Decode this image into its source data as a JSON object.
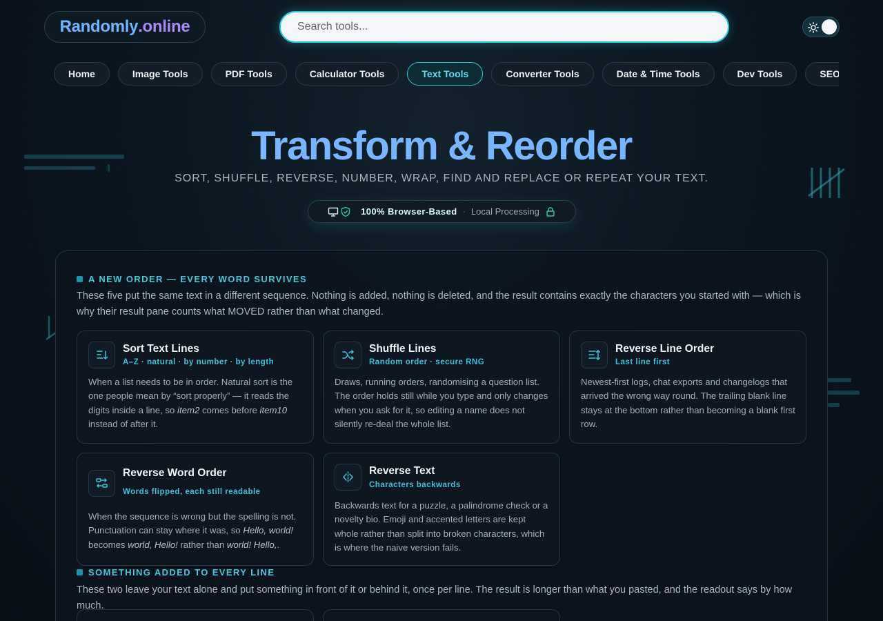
{
  "header": {
    "logo_part1": "Randomly",
    "logo_part2": ".online",
    "search_placeholder": "Search tools..."
  },
  "nav": {
    "items": [
      "Home",
      "Image Tools",
      "PDF Tools",
      "Calculator Tools",
      "Text Tools",
      "Converter Tools",
      "Date & Time Tools",
      "Dev Tools",
      "SEO"
    ],
    "active": "Text Tools"
  },
  "hero": {
    "title": "Transform & Reorder",
    "subtitle": "SORT, SHUFFLE, REVERSE, NUMBER, WRAP, FIND AND REPLACE OR REPEAT YOUR TEXT.",
    "badge_strong": "100% Browser-Based",
    "badge_sep": "·",
    "badge_weak": "Local Processing"
  },
  "sections": [
    {
      "heading": "A NEW ORDER — EVERY WORD SURVIVES",
      "description": "These five put the same text in a different sequence. Nothing is added, nothing is deleted, and the result contains exactly the characters you started with — which is why their result pane counts what MOVED rather than what changed."
    },
    {
      "heading": "SOMETHING ADDED TO EVERY LINE",
      "description": "These two leave your text alone and put something in front of it or behind it, once per line. The result is longer than what you pasted, and the readout says by how much."
    }
  ],
  "cards": [
    {
      "title": "Sort Text Lines",
      "tag": "A–Z · natural · by number · by length",
      "icon": "sort-icon",
      "body": [
        {
          "t": "When a list needs to be in order. Natural sort is the one people mean by “sort properly” — it reads the digits inside a line, so "
        },
        {
          "t": "item2",
          "em": true
        },
        {
          "t": " comes before "
        },
        {
          "t": "item10",
          "em": true
        },
        {
          "t": " instead of after it."
        }
      ]
    },
    {
      "title": "Shuffle Lines",
      "tag": "Random order · secure RNG",
      "icon": "shuffle-icon",
      "body": [
        {
          "t": "Draws, running orders, randomising a question list. The order holds still while you type and only changes when you ask for it, so editing a name does not silently re-deal the whole list."
        }
      ]
    },
    {
      "title": "Reverse Line Order",
      "tag": "Last line first",
      "icon": "reverse-lines-icon",
      "body": [
        {
          "t": "Newest-first logs, chat exports and changelogs that arrived the wrong way round. The trailing blank line stays at the bottom rather than becoming a blank first row."
        }
      ]
    },
    {
      "title": "Reverse Word Order",
      "tag": "Words flipped, each still readable",
      "icon": "swap-words-icon",
      "body": [
        {
          "t": "When the sequence is wrong but the spelling is not. Punctuation can stay where it was, so "
        },
        {
          "t": "Hello, world!",
          "em": true
        },
        {
          "t": " becomes "
        },
        {
          "t": "world, Hello!",
          "em": true
        },
        {
          "t": " rather than "
        },
        {
          "t": "world! Hello,",
          "em": true
        },
        {
          "t": "."
        }
      ]
    },
    {
      "title": "Reverse Text",
      "tag": "Characters backwards",
      "icon": "mirror-icon",
      "body": [
        {
          "t": "Backwards text for a puzzle, a palindrome check or a novelty bio. Emoji and accented letters are kept whole rather than split into broken characters, which is where the naive version fails."
        }
      ]
    }
  ],
  "colors": {
    "accent": "#46c8dd",
    "title_blue": "#7ab6ff",
    "logo_purple": "#a98cf2"
  }
}
